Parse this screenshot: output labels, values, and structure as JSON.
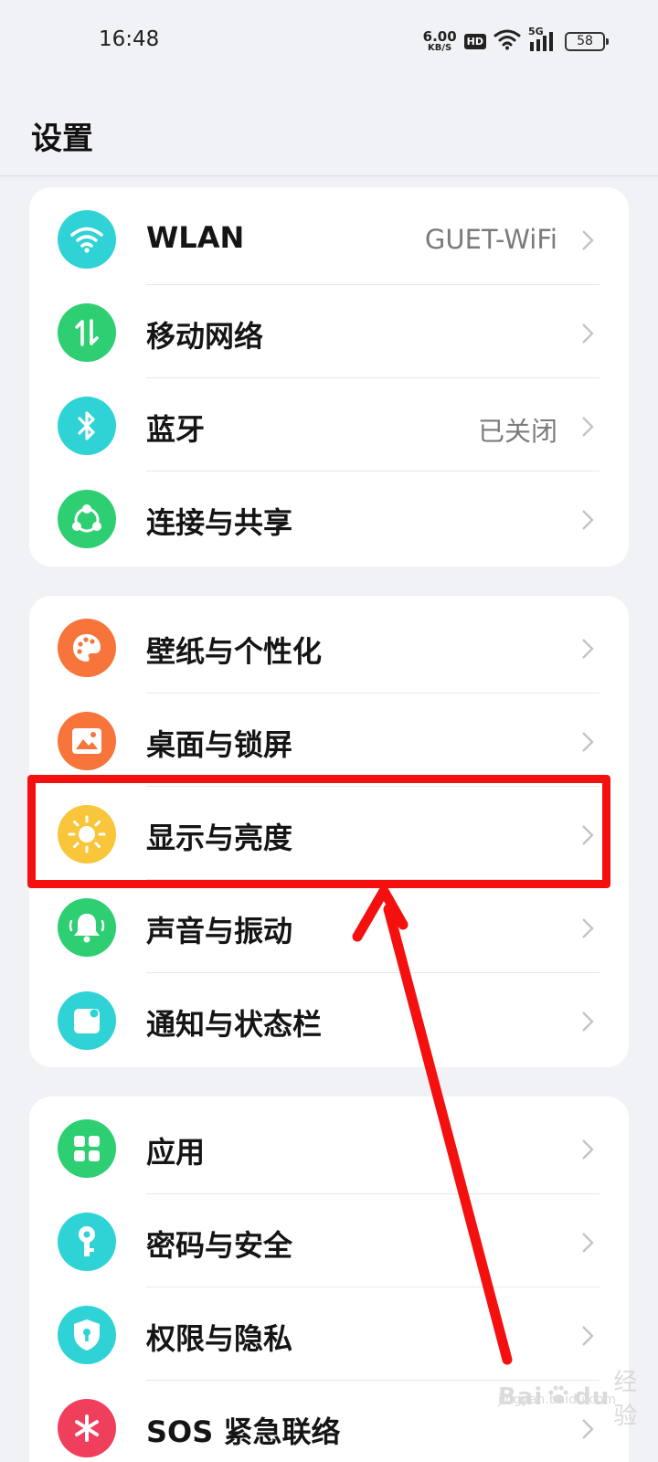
{
  "status_bar": {
    "time": "16:48",
    "net_speed_value": "6.00",
    "net_speed_unit": "KB/S",
    "hd_label": "HD",
    "network_type": "5G",
    "battery": "58"
  },
  "page": {
    "title": "设置"
  },
  "groups": [
    {
      "items": [
        {
          "label": "WLAN",
          "value": "GUET-WiFi",
          "icon": "wifi-icon",
          "icon_color": "#2fd3d6"
        },
        {
          "label": "移动网络",
          "value": "",
          "icon": "mobile-data-icon",
          "icon_color": "#2ecf72"
        },
        {
          "label": "蓝牙",
          "value": "已关闭",
          "icon": "bluetooth-icon",
          "icon_color": "#2fd3d6"
        },
        {
          "label": "连接与共享",
          "value": "",
          "icon": "share-icon",
          "icon_color": "#2ecf72"
        }
      ]
    },
    {
      "items": [
        {
          "label": "壁纸与个性化",
          "value": "",
          "icon": "palette-icon",
          "icon_color": "#f7743a"
        },
        {
          "label": "桌面与锁屏",
          "value": "",
          "icon": "picture-icon",
          "icon_color": "#f7743a"
        },
        {
          "label": "显示与亮度",
          "value": "",
          "icon": "sun-icon",
          "icon_color": "#f9c63b"
        },
        {
          "label": "声音与振动",
          "value": "",
          "icon": "bell-icon",
          "icon_color": "#2ecf72"
        },
        {
          "label": "通知与状态栏",
          "value": "",
          "icon": "notification-icon",
          "icon_color": "#2fd3d6"
        }
      ]
    },
    {
      "items": [
        {
          "label": "应用",
          "value": "",
          "icon": "apps-icon",
          "icon_color": "#2ecf72"
        },
        {
          "label": "密码与安全",
          "value": "",
          "icon": "key-icon",
          "icon_color": "#2fd3d6"
        },
        {
          "label": "权限与隐私",
          "value": "",
          "icon": "shield-icon",
          "icon_color": "#2fd3d6"
        },
        {
          "label": "SOS 紧急联络",
          "value": "",
          "icon": "sos-icon",
          "icon_color": "#ef3f5c"
        }
      ]
    }
  ],
  "annotation": {
    "color": "#f51010"
  },
  "watermark": {
    "brand": "Bai",
    "brand_suffix": "du",
    "sub": "经验",
    "url": "jingyan.baidu.com"
  }
}
